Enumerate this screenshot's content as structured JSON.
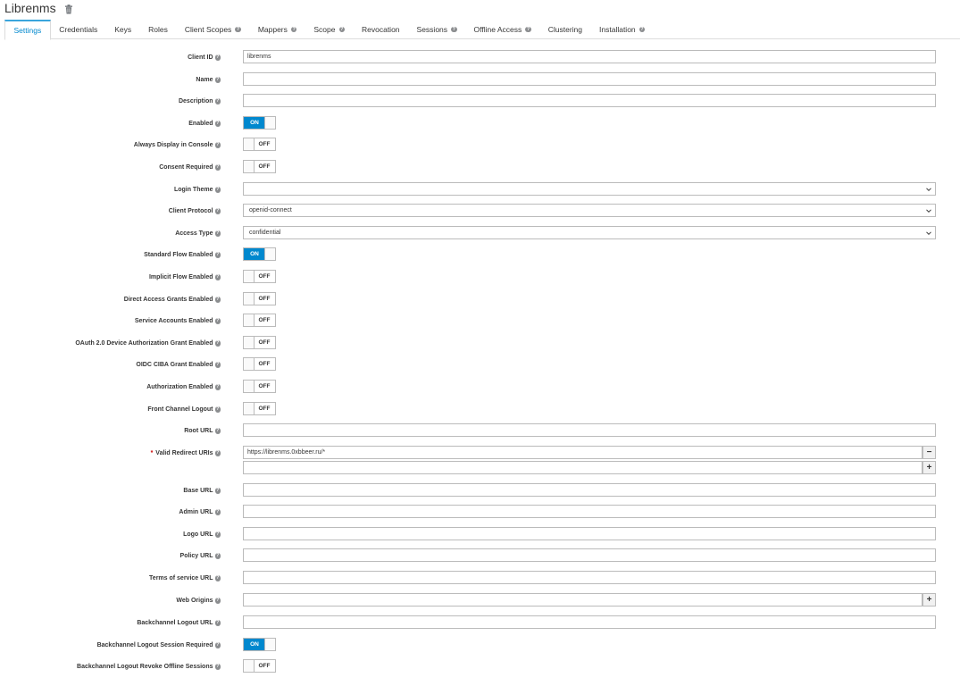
{
  "header": {
    "title": "Librenms",
    "delete_icon": "trash-icon"
  },
  "tabs": [
    {
      "label": "Settings",
      "help": false,
      "active": true
    },
    {
      "label": "Credentials",
      "help": false
    },
    {
      "label": "Keys",
      "help": false
    },
    {
      "label": "Roles",
      "help": false
    },
    {
      "label": "Client Scopes",
      "help": true
    },
    {
      "label": "Mappers",
      "help": true
    },
    {
      "label": "Scope",
      "help": true
    },
    {
      "label": "Revocation",
      "help": false
    },
    {
      "label": "Sessions",
      "help": true
    },
    {
      "label": "Offline Access",
      "help": true
    },
    {
      "label": "Clustering",
      "help": false
    },
    {
      "label": "Installation",
      "help": true
    }
  ],
  "form": {
    "client_id": {
      "label": "Client ID",
      "value": "librenms"
    },
    "name": {
      "label": "Name",
      "value": ""
    },
    "description": {
      "label": "Description",
      "value": ""
    },
    "enabled": {
      "label": "Enabled",
      "state": "ON"
    },
    "always_display": {
      "label": "Always Display in Console",
      "state": "OFF"
    },
    "consent_required": {
      "label": "Consent Required",
      "state": "OFF"
    },
    "login_theme": {
      "label": "Login Theme",
      "value": ""
    },
    "client_protocol": {
      "label": "Client Protocol",
      "value": "openid-connect"
    },
    "access_type": {
      "label": "Access Type",
      "value": "confidential"
    },
    "standard_flow": {
      "label": "Standard Flow Enabled",
      "state": "ON"
    },
    "implicit_flow": {
      "label": "Implicit Flow Enabled",
      "state": "OFF"
    },
    "direct_access": {
      "label": "Direct Access Grants Enabled",
      "state": "OFF"
    },
    "service_accounts": {
      "label": "Service Accounts Enabled",
      "state": "OFF"
    },
    "device_grant": {
      "label": "OAuth 2.0 Device Authorization Grant Enabled",
      "state": "OFF"
    },
    "ciba": {
      "label": "OIDC CIBA Grant Enabled",
      "state": "OFF"
    },
    "authorization": {
      "label": "Authorization Enabled",
      "state": "OFF"
    },
    "front_channel": {
      "label": "Front Channel Logout",
      "state": "OFF"
    },
    "root_url": {
      "label": "Root URL",
      "value": ""
    },
    "redirect_uris": {
      "label": "Valid Redirect URIs",
      "required_mark": "*",
      "values": [
        "https://librenms.0xbbeer.ru/*",
        ""
      ],
      "remove_label": "−",
      "add_label": "+"
    },
    "base_url": {
      "label": "Base URL",
      "value": ""
    },
    "admin_url": {
      "label": "Admin URL",
      "value": ""
    },
    "logo_url": {
      "label": "Logo URL",
      "value": ""
    },
    "policy_url": {
      "label": "Policy URL",
      "value": ""
    },
    "tos_url": {
      "label": "Terms of service URL",
      "value": ""
    },
    "web_origins": {
      "label": "Web Origins",
      "value": "",
      "add_label": "+"
    },
    "backchannel_url": {
      "label": "Backchannel Logout URL",
      "value": ""
    },
    "backchannel_session": {
      "label": "Backchannel Logout Session Required",
      "state": "ON"
    },
    "backchannel_revoke": {
      "label": "Backchannel Logout Revoke Offline Sessions",
      "state": "OFF"
    }
  },
  "colors": {
    "accent": "#0088ce",
    "active_tab_border": "#39a5dc",
    "required": "#cc0000"
  }
}
